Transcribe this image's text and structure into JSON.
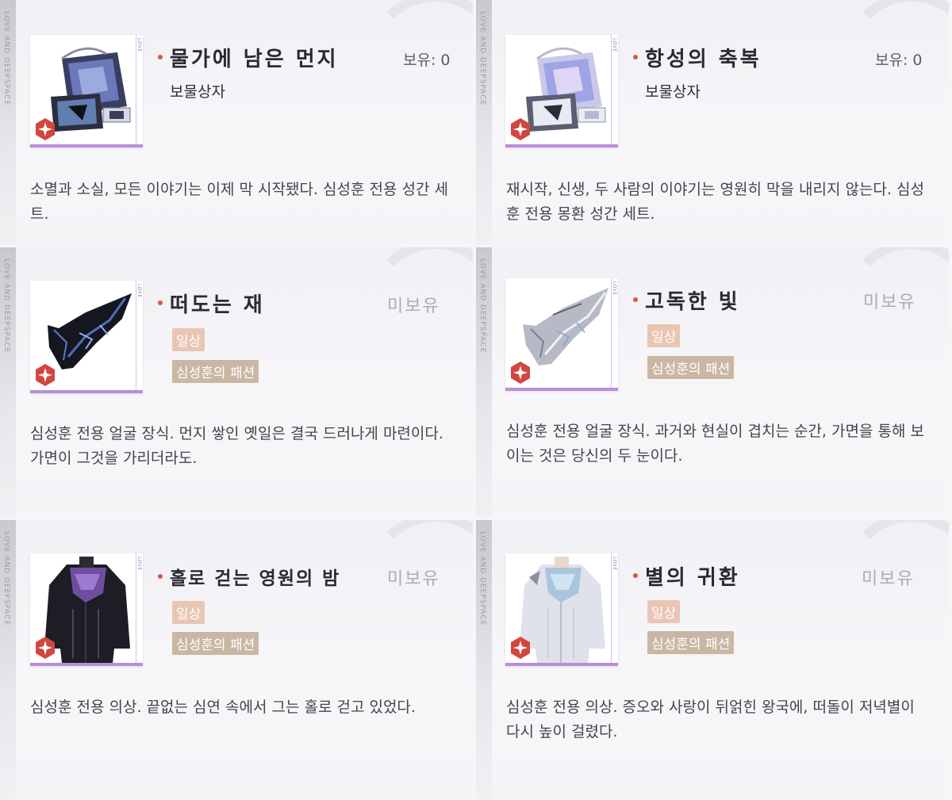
{
  "brand_side_text": "LOVE AND DEEPSPACE",
  "thumb_side_text": "LOVE",
  "colors": {
    "accent_dot": "#d9593d",
    "thumb_border": "#b98ed8",
    "rarity_tag": "#e9c5b4",
    "series_tag": "#cab7a3",
    "badge": "#d3463f"
  },
  "items": [
    {
      "title": "물가에 남은 먼지",
      "subtitle": "보물상자",
      "status": "보유: 0",
      "description": "소멸과 소실, 모든 이야기는 이제 막 시작됐다. 심성훈 전용 성간 세트.",
      "icon": "dark-treasure-box-icon"
    },
    {
      "title": "항성의 축복",
      "subtitle": "보물상자",
      "status": "보유: 0",
      "description": "재시작, 신생, 두 사람의 이야기는 영원히 막을 내리지 않는다. 심성훈 전용 몽환 성간 세트.",
      "icon": "light-treasure-box-icon"
    },
    {
      "title": "떠도는 재",
      "status": "미보유",
      "rarity": "일상",
      "series": "심성훈의 패션",
      "description": "심성훈 전용 얼굴 장식. 먼지 쌓인 옛일은 결국 드러나게 마련이다. 가면이 그것을 가리더라도.",
      "icon": "dark-mask-icon"
    },
    {
      "title": "고독한 빛",
      "status": "미보유",
      "rarity": "일상",
      "series": "심성훈의 패션",
      "description": "심성훈 전용 얼굴 장식. 과거와 현실이 겹치는 순간, 가면을 통해 보이는 것은 당신의 두 눈이다.",
      "icon": "silver-mask-icon"
    },
    {
      "title": "홀로 걷는 영원의 밤",
      "status": "미보유",
      "rarity": "일상",
      "series": "심성훈의 패션",
      "description": "심성훈 전용 의상. 끝없는 심연 속에서 그는 홀로 걷고 있었다.",
      "icon": "dark-outfit-icon"
    },
    {
      "title": "별의 귀환",
      "status": "미보유",
      "rarity": "일상",
      "series": "심성훈의 패션",
      "description": "심성훈 전용 의상. 증오와 사랑이 뒤얽힌 왕국에, 떠돌이 저녁별이 다시 높이 걸렸다.",
      "icon": "white-outfit-icon"
    }
  ]
}
